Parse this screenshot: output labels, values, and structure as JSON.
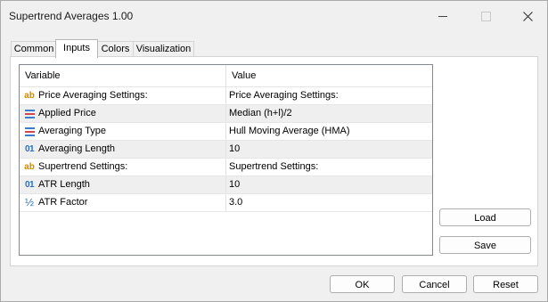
{
  "window": {
    "title": "Supertrend Averages 1.00"
  },
  "tabs": [
    {
      "label": "Common",
      "active": false
    },
    {
      "label": "Inputs",
      "active": true
    },
    {
      "label": "Colors",
      "active": false
    },
    {
      "label": "Visualization",
      "active": false
    }
  ],
  "grid": {
    "columns": {
      "variable": "Variable",
      "value": "Value"
    },
    "rows": [
      {
        "icon": "text-icon",
        "variable": "Price Averaging Settings:",
        "value": "Price Averaging Settings:"
      },
      {
        "icon": "list-icon",
        "variable": "Applied Price",
        "value": "Median (h+l)/2"
      },
      {
        "icon": "list-icon",
        "variable": "Averaging Type",
        "value": "Hull Moving Average (HMA)"
      },
      {
        "icon": "integer-icon",
        "variable": "Averaging Length",
        "value": "10"
      },
      {
        "icon": "text-icon",
        "variable": "Supertrend Settings:",
        "value": "Supertrend Settings:"
      },
      {
        "icon": "integer-icon",
        "variable": "ATR Length",
        "value": "10"
      },
      {
        "icon": "double-icon",
        "variable": "ATR Factor",
        "value": "3.0"
      }
    ]
  },
  "buttons": {
    "load": "Load",
    "save": "Save",
    "ok": "OK",
    "cancel": "Cancel",
    "reset": "Reset"
  },
  "icons": {
    "text": "ab",
    "integer": "01",
    "double": "½"
  },
  "colors": {
    "text_icon": "#d48a00",
    "number_icon": "#2c6fc2",
    "alt_row": "#efefef"
  }
}
